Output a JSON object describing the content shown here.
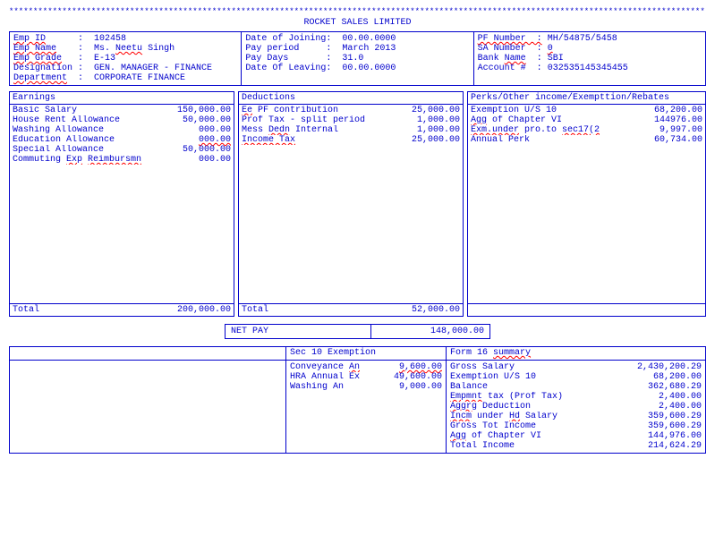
{
  "company": "ROCKET SALES LIMITED",
  "employee": {
    "id_lbl": "Emp ID",
    "id": "102458",
    "name_lbl": "Emp Name",
    "name": "Ms. Neetu Singh",
    "grade_lbl": "Emp Grade",
    "grade": "E-13",
    "desig_lbl": "Designation",
    "desig": "GEN. MANAGER - FINANCE",
    "dept_lbl": "Department",
    "dept": "CORPORATE FINANCE"
  },
  "period": {
    "doj_lbl": "Date of Joining",
    "doj": "00.00.0000",
    "pp_lbl": "Pay period",
    "pp": "March 2013",
    "pd_lbl": "Pay Days",
    "pd": "31.0",
    "dol_lbl": "Date Of Leaving",
    "dol": "00.00.0000"
  },
  "bank": {
    "pf_lbl": "PF Number",
    "pf": "MH/54875/5458",
    "sa_lbl": "SA Number",
    "sa": "0",
    "bn_lbl": "Bank Name",
    "bn": "SBI",
    "ac_lbl": "Account #",
    "ac": "032535145345455"
  },
  "earnings": {
    "title": "Earnings",
    "items": [
      {
        "l": "Basic Salary",
        "v": "150,000.00"
      },
      {
        "l": "House Rent Allowance",
        "v": "50,000.00"
      },
      {
        "l": "Washing Allowance",
        "v": "000.00"
      },
      {
        "l": "Education Allowance",
        "v": "000.00"
      },
      {
        "l": "Special Allowance",
        "v": "50,000.00"
      },
      {
        "l": "Commuting Exp Reimbursmn",
        "v": "000.00"
      }
    ],
    "total_lbl": "Total",
    "total": "200,000.00"
  },
  "deductions": {
    "title": "Deductions",
    "items": [
      {
        "l": "Ee PF contribution",
        "v": "25,000.00"
      },
      {
        "l": "Prof Tax - split period",
        "v": "1,000.00"
      },
      {
        "l": "Mess Dedn Internal",
        "v": "1,000.00"
      },
      {
        "l": "Income Tax",
        "v": "25,000.00"
      }
    ],
    "total_lbl": "Total",
    "total": "52,000.00"
  },
  "perks": {
    "title": "Perks/Other income/Exempttion/Rebates",
    "items": [
      {
        "l": "Exemption U/S 10",
        "v": "68,200.00"
      },
      {
        "l": "Agg of Chapter VI",
        "v": "144976.00"
      },
      {
        "l": "Exm.under pro.to sec17(2",
        "v": "9,997.00"
      },
      {
        "l": "Annual Perk",
        "v": "60,734.00"
      }
    ]
  },
  "netpay": {
    "lbl": "NET PAY",
    "val": "148,000.00"
  },
  "sec10": {
    "title": "Sec 10 Exemption",
    "items": [
      {
        "l": "Conveyance An",
        "v": "9,600.00"
      },
      {
        "l": "HRA Annual Ex",
        "v": "49,600.00"
      },
      {
        "l": "Washing An",
        "v": "9,000.00"
      }
    ]
  },
  "form16": {
    "title": "Form 16 summary",
    "items": [
      {
        "l": "Gross Salary",
        "v": "2,430,200.29"
      },
      {
        "l": "Exemption U/S 10",
        "v": "68,200.00"
      },
      {
        "l": "Balance",
        "v": "362,680.29"
      },
      {
        "l": "Empmnt tax (Prof Tax)",
        "v": "2,400.00"
      },
      {
        "l": "Aggrg Deduction",
        "v": "2,400.00"
      },
      {
        "l": "Incm under Hd Salary",
        "v": "359,600.29"
      },
      {
        "l": "Gross Tot Income",
        "v": "359,600.29"
      },
      {
        "l": "Agg of Chapter VI",
        "v": "144,976.00"
      },
      {
        "l": "Total Income",
        "v": "214,624.29"
      }
    ]
  }
}
